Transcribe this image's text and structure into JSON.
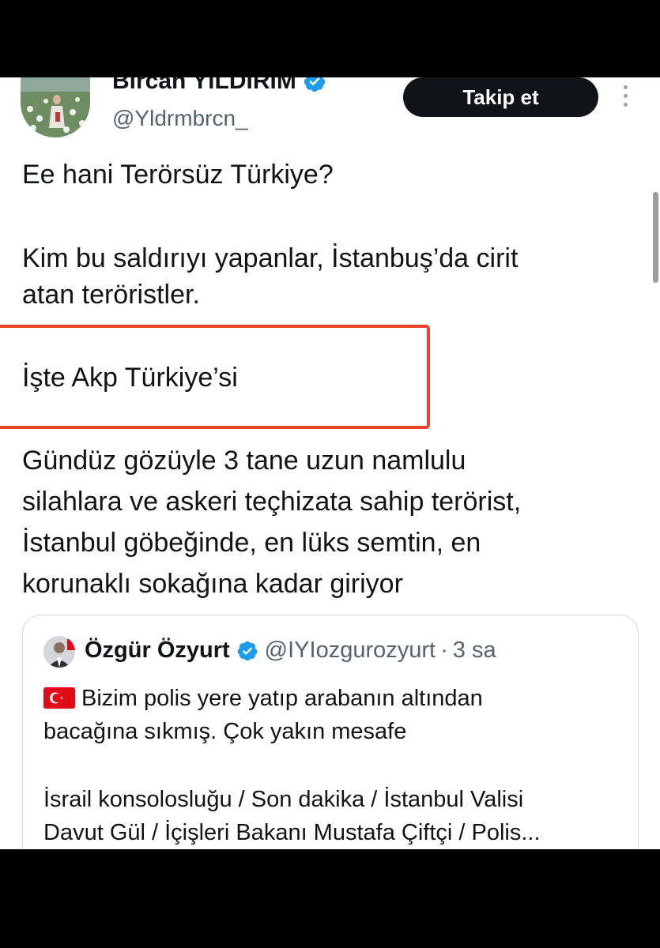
{
  "author": {
    "name": "Bircan YILDIRIM",
    "handle": "@Yldrmbrcn_",
    "verified_icon": "verified-badge-icon",
    "follow_label": "Takip et"
  },
  "tweet": {
    "line1": "Ee hani Terörsüz Türkiye?",
    "line2a": "Kim bu saldırıyı yapanlar, İstanbuş’da cirit",
    "line2b": "atan teröristler.",
    "highlighted": "İşte Akp Türkiye’si",
    "line4a": "Gündüz gözüyle 3 tane uzun namlulu",
    "line4b": "silahlara ve askeri teçhizata sahip terörist,",
    "line4c": "İstanbul göbeğinde, en lüks semtin, en",
    "line4d": "korunaklı sokağına kadar giriyor"
  },
  "quoted": {
    "name": "Özgür Özyurt",
    "handle": "@IYIozgurozyurt",
    "separator": "·",
    "time": "3 sa",
    "flag_icon": "turkey-flag-icon",
    "text1": "Bizim polis yere yatıp arabanın altından",
    "text2": "bacağına sıkmış. Çok yakın mesafe",
    "text3": "İsrail konsolosluğu / Son dakika / İstanbul Valisi",
    "text4": "Davut Gül / İçişleri Bakanı Mustafa Çiftçi / Polis..."
  },
  "colors": {
    "highlight_border": "#e8452c",
    "verified_blue": "#1d9bf0",
    "follow_bg": "#0f1419"
  }
}
